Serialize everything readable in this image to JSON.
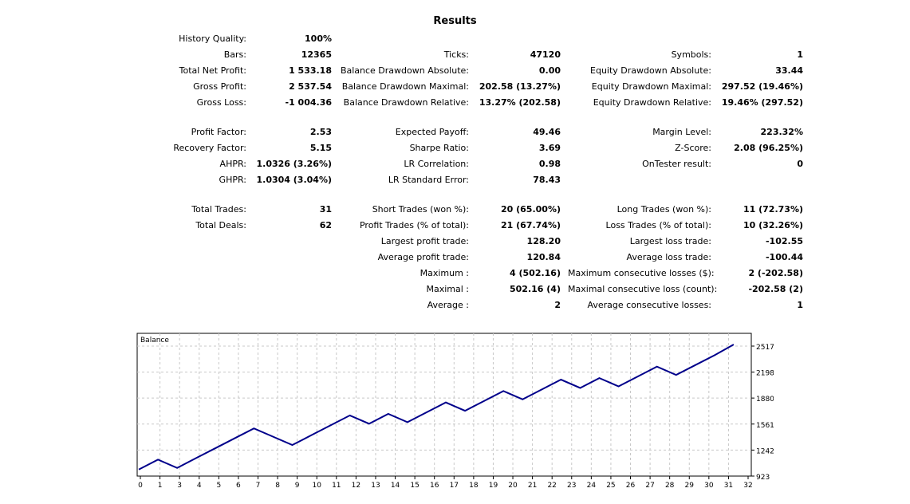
{
  "title": "Results",
  "rows": [
    {
      "c1": {
        "label": "History Quality:",
        "value": "100%"
      }
    },
    {
      "c1": {
        "label": "Bars:",
        "value": "12365"
      },
      "c2": {
        "label": "Ticks:",
        "value": "47120"
      },
      "c3": {
        "label": "Symbols:",
        "value": "1"
      }
    },
    {
      "c1": {
        "label": "Total Net Profit:",
        "value": "1 533.18"
      },
      "c2": {
        "label": "Balance Drawdown Absolute:",
        "value": "0.00"
      },
      "c3": {
        "label": "Equity Drawdown Absolute:",
        "value": "33.44"
      }
    },
    {
      "c1": {
        "label": "Gross Profit:",
        "value": "2 537.54"
      },
      "c2": {
        "label": "Balance Drawdown Maximal:",
        "value": "202.58 (13.27%)"
      },
      "c3": {
        "label": "Equity Drawdown Maximal:",
        "value": "297.52 (19.46%)"
      }
    },
    {
      "c1": {
        "label": "Gross Loss:",
        "value": "-1 004.36"
      },
      "c2": {
        "label": "Balance Drawdown Relative:",
        "value": "13.27% (202.58)"
      },
      "c3": {
        "label": "Equity Drawdown Relative:",
        "value": "19.46% (297.52)"
      }
    },
    null,
    {
      "c1": {
        "label": "Profit Factor:",
        "value": "2.53"
      },
      "c2": {
        "label": "Expected Payoff:",
        "value": "49.46"
      },
      "c3": {
        "label": "Margin Level:",
        "value": "223.32%"
      }
    },
    {
      "c1": {
        "label": "Recovery Factor:",
        "value": "5.15"
      },
      "c2": {
        "label": "Sharpe Ratio:",
        "value": "3.69"
      },
      "c3": {
        "label": "Z-Score:",
        "value": "2.08 (96.25%)"
      }
    },
    {
      "c1": {
        "label": "AHPR:",
        "value": "1.0326 (3.26%)"
      },
      "c2": {
        "label": "LR Correlation:",
        "value": "0.98"
      },
      "c3": {
        "label": "OnTester result:",
        "value": "0"
      }
    },
    {
      "c1": {
        "label": "GHPR:",
        "value": "1.0304 (3.04%)"
      },
      "c2": {
        "label": "LR Standard Error:",
        "value": "78.43"
      }
    },
    null,
    {
      "c1": {
        "label": "Total Trades:",
        "value": "31"
      },
      "c2": {
        "label": "Short Trades (won %):",
        "value": "20 (65.00%)"
      },
      "c3": {
        "label": "Long Trades (won %):",
        "value": "11 (72.73%)"
      }
    },
    {
      "c1": {
        "label": "Total Deals:",
        "value": "62"
      },
      "c2": {
        "label": "Profit Trades (% of total):",
        "value": "21 (67.74%)"
      },
      "c3": {
        "label": "Loss Trades (% of total):",
        "value": "10 (32.26%)"
      }
    },
    {
      "c2": {
        "label": "Largest profit trade:",
        "value": "128.20"
      },
      "c3": {
        "label": "Largest loss trade:",
        "value": "-102.55"
      }
    },
    {
      "c2": {
        "label": "Average profit trade:",
        "value": "120.84"
      },
      "c3": {
        "label": "Average loss trade:",
        "value": "-100.44"
      }
    },
    {
      "c2": {
        "label": "Maximum :",
        "value": "4 (502.16)"
      },
      "c3": {
        "label": "Maximum consecutive losses ($):",
        "value": "2 (-202.58)"
      }
    },
    {
      "c2": {
        "label": "Maximal :",
        "value": "502.16 (4)"
      },
      "c3": {
        "label": "Maximal consecutive loss (count):",
        "value": "-202.58 (2)"
      }
    },
    {
      "c2": {
        "label": "Average :",
        "value": "2"
      },
      "c3": {
        "label": "Average consecutive losses:",
        "value": "1"
      }
    }
  ],
  "chart_data": {
    "type": "line",
    "title": "Balance",
    "x_ticks": [
      0,
      1,
      3,
      4,
      5,
      6,
      7,
      8,
      9,
      10,
      11,
      12,
      13,
      14,
      15,
      16,
      17,
      18,
      19,
      20,
      21,
      22,
      23,
      24,
      25,
      26,
      27,
      28,
      29,
      30,
      31,
      32
    ],
    "y_ticks": [
      923,
      1242,
      1561,
      1880,
      2198,
      2517
    ],
    "ylim": [
      923,
      2517
    ],
    "xlim": [
      0,
      32
    ],
    "grid": true,
    "line_color": "#00008b",
    "series": [
      {
        "x": [
          0,
          1,
          2,
          3,
          4,
          5,
          6,
          7,
          8,
          9,
          10,
          11,
          12,
          13,
          14,
          15,
          16,
          17,
          18,
          19,
          20,
          21,
          22,
          23,
          24,
          25,
          26,
          27,
          28,
          29,
          30,
          31
        ],
        "values": [
          1004,
          1125,
          1023,
          1145,
          1266,
          1387,
          1508,
          1406,
          1304,
          1425,
          1546,
          1667,
          1565,
          1686,
          1584,
          1705,
          1826,
          1724,
          1845,
          1966,
          1864,
          1985,
          2106,
          2004,
          2125,
          2023,
          2144,
          2265,
          2163,
          2284,
          2405,
          2537
        ]
      }
    ]
  }
}
